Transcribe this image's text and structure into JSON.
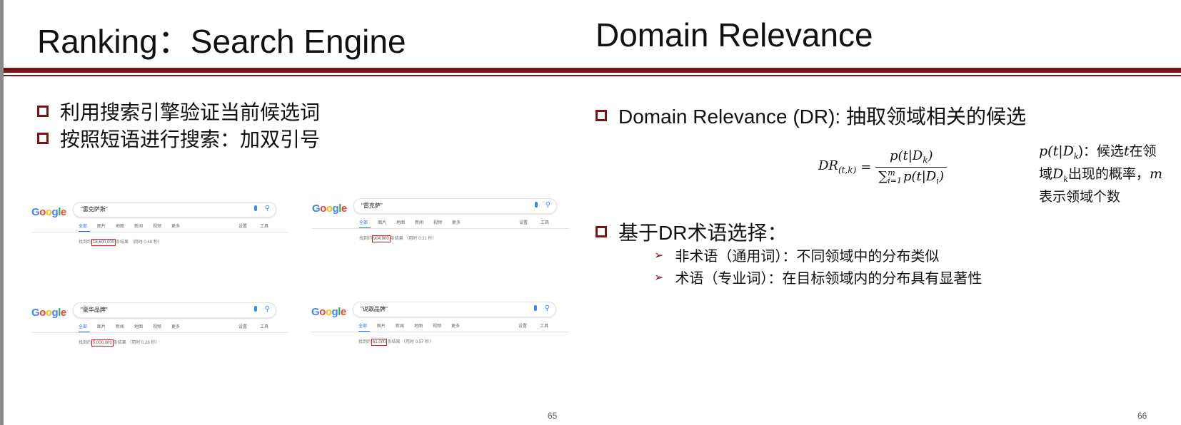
{
  "left_slide": {
    "title": "Ranking：Search Engine",
    "bullets": [
      "利用搜索引擎验证当前候选词",
      "按照短语进行搜索：加双引号"
    ],
    "page_number": "65",
    "screenshots": [
      {
        "logo": "Google",
        "query": "\"雷克萨斯\"",
        "tabs": [
          "全部",
          "图片",
          "地图",
          "新闻",
          "视频",
          "更多"
        ],
        "tools": [
          "设置",
          "工具"
        ],
        "result_prefix": "找到约",
        "count": "18,600,000",
        "result_suffix": "条结果 （用时 0.48 秒）"
      },
      {
        "logo": "Google",
        "query": "\"雷克萨\"",
        "tabs": [
          "全部",
          "图片",
          "地图",
          "新闻",
          "视频",
          "更多"
        ],
        "tools": [
          "设置",
          "工具"
        ],
        "result_prefix": "找到约",
        "count": "904,000",
        "result_suffix": "条结果 （用时 0.31 秒）"
      },
      {
        "logo": "Google",
        "query": "\"豪华品牌\"",
        "tabs": [
          "全部",
          "图片",
          "新闻",
          "地图",
          "视频",
          "更多"
        ],
        "tools": [
          "设置",
          "工具"
        ],
        "result_prefix": "找到约",
        "count": "5,000,000",
        "result_suffix": "条结果 （用时 0.28 秒）"
      },
      {
        "logo": "Google",
        "query": "\"说歌品牌\"",
        "tabs": [
          "全部",
          "图片",
          "新闻",
          "地图",
          "视频",
          "更多"
        ],
        "tools": [
          "设置",
          "工具"
        ],
        "result_prefix": "找到约",
        "count": "61,000",
        "result_suffix": "条结果 （用时 0.57 秒）"
      }
    ]
  },
  "right_slide": {
    "title": "Domain Relevance",
    "bullet1": "Domain Relevance (DR): 抽取领域相关的候选",
    "formula": {
      "lhs": "DR",
      "lhs_sub": "(t,k)",
      "numerator": "p(t|D",
      "numerator_sub": "k",
      "denominator_sum": "∑",
      "denominator_sup": "m",
      "denominator_sub": "i=1",
      "denominator_term": "p(t|D",
      "denominator_term_sub": "i"
    },
    "note_line1_a": "p(t|D",
    "note_line1_sub": "k",
    "note_line1_b": ")：候选",
    "note_line1_t": "t",
    "note_line1_c": "在领",
    "note_line2_a": "域",
    "note_line2_D": "D",
    "note_line2_sub": "k",
    "note_line2_b": "出现的概率，",
    "note_line2_m": "m",
    "note_line3": "表示领域个数",
    "bullet2": "基于DR术语选择：",
    "subbullets": [
      "非术语（通用词）：不同领域中的分布类似",
      "术语（专业词）：在目标领域内的分布具有显著性"
    ],
    "page_number": "66"
  },
  "colors": {
    "accent": "#7b1414",
    "highlight_box": "#e02020",
    "google_blue": "#4285f4"
  }
}
